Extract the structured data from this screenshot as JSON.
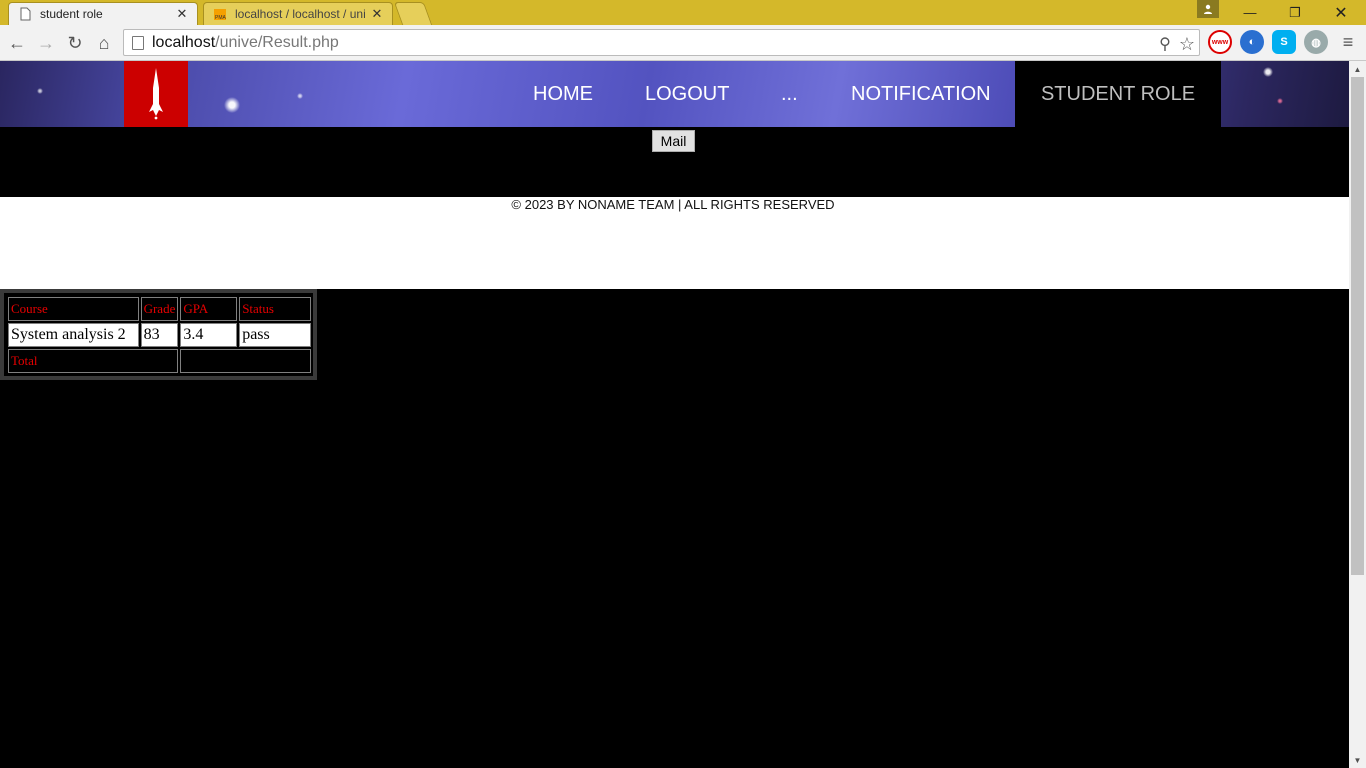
{
  "browser": {
    "tabs": [
      {
        "title": "student role",
        "active": true
      },
      {
        "title": "localhost / localhost / uni",
        "active": false
      }
    ],
    "url_host": "localhost",
    "url_path": "/unive/Result.php",
    "extensions": [
      "zoom-icon",
      "bookmark-star-icon",
      "no-www-icon",
      "globe-icon",
      "skype-icon",
      "planet-icon",
      "menu-icon"
    ]
  },
  "header": {
    "nav": {
      "home": "HOME",
      "logout": "LOGOUT",
      "more": "...",
      "notification": "NOTIFICATION",
      "student_role": "STUDENT ROLE"
    }
  },
  "mail_button": "Mail",
  "footer": {
    "copyright": "© 2023 BY NONAME TEAM | ALL RIGHTS RESERVED"
  },
  "results": {
    "headers": {
      "course": "Course",
      "grade": "Grade",
      "gpa": "GPA",
      "status": "Status"
    },
    "rows": [
      {
        "course": "System analysis 2",
        "grade": "83",
        "gpa": "3.4",
        "status": "pass"
      }
    ],
    "total_label": "Total",
    "total_value": ""
  },
  "colors": {
    "chrome_frame": "#d4b82a",
    "logo_red": "#cc0000",
    "table_header_text": "#e60000"
  }
}
